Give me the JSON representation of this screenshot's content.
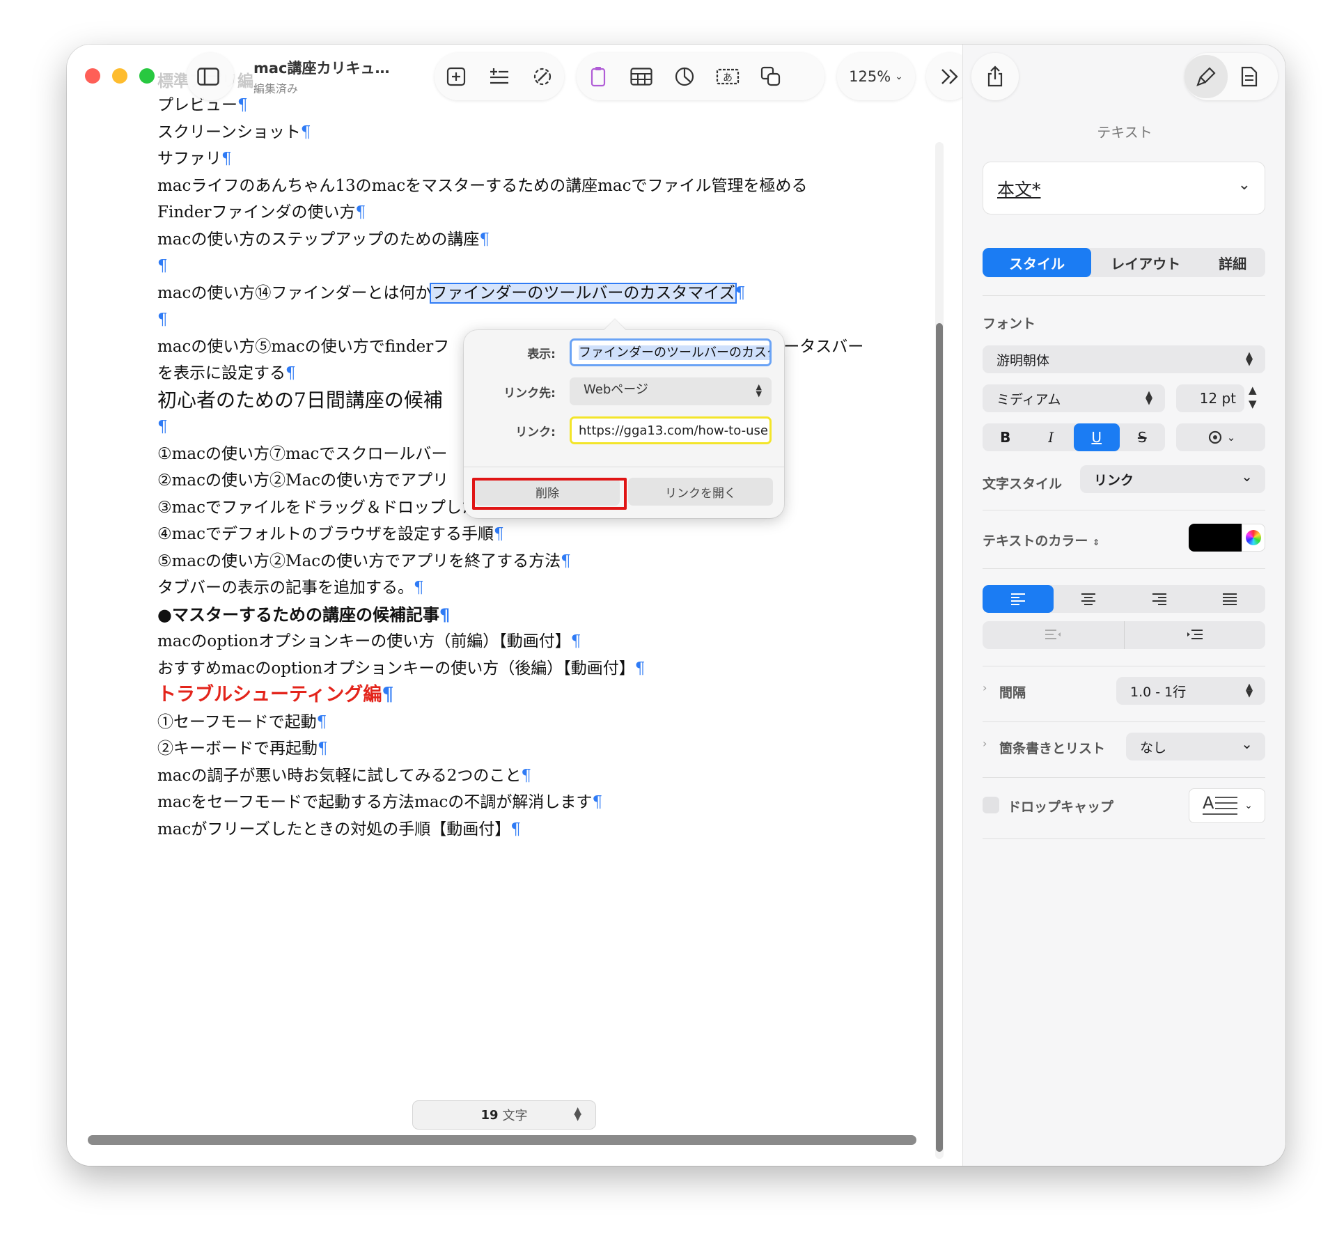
{
  "window": {
    "title": "mac講座カリキュ…",
    "subtitle": "編集済み",
    "zoom": "125%"
  },
  "document": {
    "faded_lines": [
      "標準アプリ編"
    ],
    "lines": [
      {
        "text": "プレビュー",
        "style": "normal"
      },
      {
        "text": "スクリーンショット",
        "style": "normal"
      },
      {
        "text": "サファリ",
        "style": "normal"
      },
      {
        "text": "macライフのあんちゃん13のmacをマスターするための講座macでファイル管理を極める",
        "style": "normal",
        "nopil": true
      },
      {
        "text": "Finderファインダの使い方",
        "style": "normal"
      },
      {
        "text": "macの使い方のステップアップのための講座",
        "style": "normal"
      },
      {
        "text": "",
        "style": "normal"
      },
      {
        "text": "macの使い方⑭ファインダーとは何か",
        "style": "link",
        "link_text": "ファインダーのツールバーのカスタマイズ"
      },
      {
        "text": "",
        "style": "normal"
      },
      {
        "text": "macの使い方⑤macの使い方でfinderフ",
        "style": "normal",
        "nopil": true,
        "tail": "ータスバー"
      },
      {
        "text": "を表示に設定する",
        "style": "normal"
      },
      {
        "text": "初心者のための7日間講座の候補",
        "style": "h1",
        "nopil": true
      },
      {
        "text": "",
        "style": "normal"
      },
      {
        "text": "①macの使い方⑦macでスクロールバー",
        "style": "normal",
        "nopil": true
      },
      {
        "text": "②macの使い方②Macの使い方でアプリ",
        "style": "normal",
        "nopil": true
      },
      {
        "text": "③macでファイルをドラッグ＆ドロップしたときの動作の基本",
        "style": "normal"
      },
      {
        "text": "④macでデフォルトのブラウザを設定する手順",
        "style": "normal"
      },
      {
        "text": "⑤macの使い方②Macの使い方でアプリを終了する方法",
        "style": "normal"
      },
      {
        "text": "タブバーの表示の記事を追加する。",
        "style": "normal"
      },
      {
        "text": "●マスターするための講座の候補記事",
        "style": "bold"
      },
      {
        "text": "macのoptionオプションキーの使い方（前編）【動画付】",
        "style": "normal"
      },
      {
        "text": "おすすめmacのoptionオプションキーの使い方（後編）【動画付】",
        "style": "normal"
      },
      {
        "text": "トラブルシューティング編",
        "style": "red"
      },
      {
        "text": "①セーフモードで起動",
        "style": "normal"
      },
      {
        "text": "②キーボードで再起動",
        "style": "normal"
      },
      {
        "text": "macの調子が悪い時お気軽に試してみる2つのこと",
        "style": "normal"
      },
      {
        "text": "macをセーフモードで起動する方法macの不調が解消します",
        "style": "normal"
      },
      {
        "text": "macがフリーズしたときの対処の手順【動画付】",
        "style": "normal"
      }
    ],
    "pilcrow": "¶",
    "word_count": {
      "value": "19",
      "unit": "文字"
    }
  },
  "link_popover": {
    "display_label": "表示:",
    "display_value": "ファインダーのツールバーのカスタマイズ",
    "link_to_label": "リンク先:",
    "link_to_value": "Webページ",
    "link_label": "リンク:",
    "link_value": "https://gga13.com/how-to-use",
    "delete_button": "削除",
    "open_button": "リンクを開く"
  },
  "sidebar": {
    "section_title": "テキスト",
    "paragraph_style": "本文*",
    "tabs": [
      "スタイル",
      "レイアウト",
      "詳細"
    ],
    "active_tab": "スタイル",
    "font_label": "フォント",
    "font_family": "游明朝体",
    "font_weight": "ミディアム",
    "font_size": "12 pt",
    "char_style_label": "文字スタイル",
    "char_style_value": "リンク",
    "text_color_label": "テキストのカラー",
    "spacing_label": "間隔",
    "spacing_value": "1.0 - 1行",
    "bullets_label": "箇条書きとリスト",
    "bullets_value": "なし",
    "dropcap_label": "ドロップキャップ"
  },
  "colors": {
    "accent": "#1b7cf3",
    "pilcrow": "#2f7bf5",
    "red_heading": "#e3241b",
    "highlight_box": "#e01515",
    "link_field_border": "#f3e52a"
  }
}
